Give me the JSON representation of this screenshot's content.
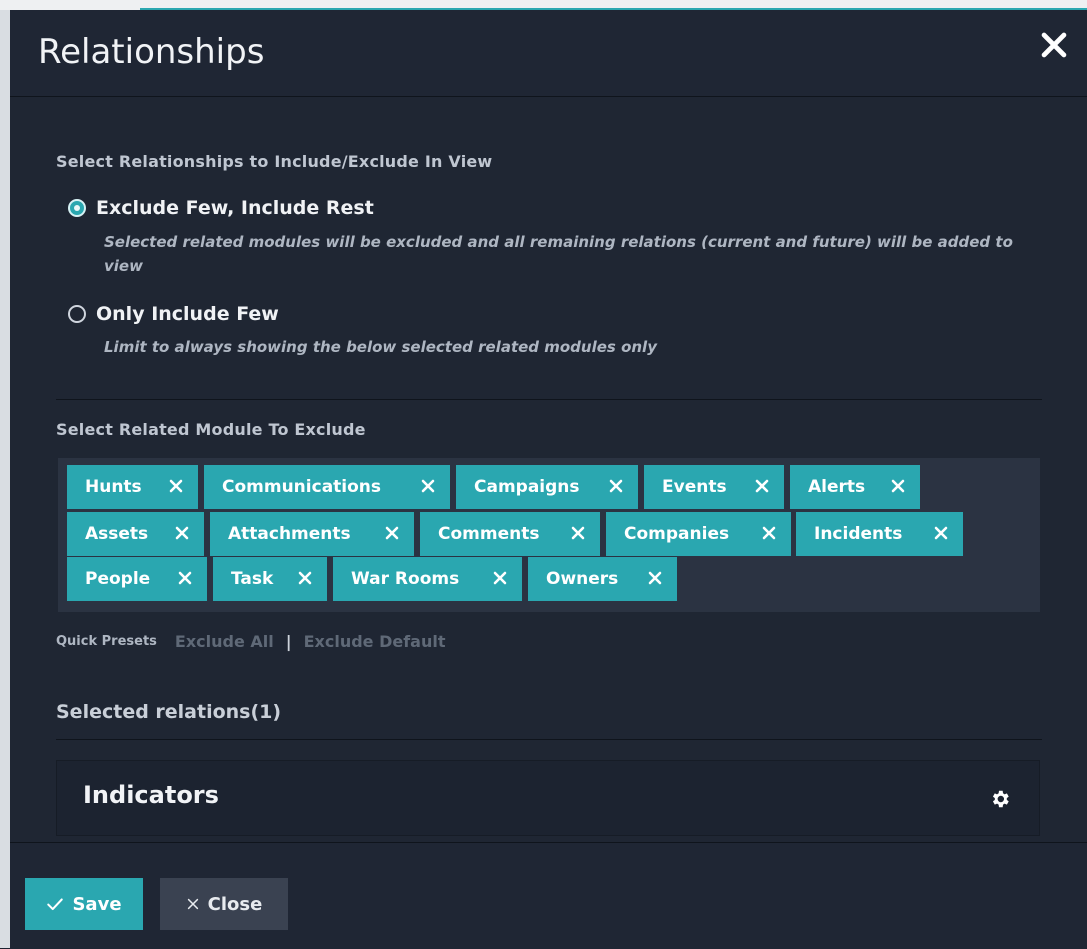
{
  "dialog": {
    "title": "Relationships"
  },
  "include_mode": {
    "heading": "Select Relationships to Include/Exclude In View",
    "options": [
      {
        "label": "Exclude Few, Include Rest",
        "help": "Selected related modules will be excluded and all remaining relations (current and future) will be added to view",
        "checked": true
      },
      {
        "label": "Only Include Few",
        "help": "Limit to always showing the below selected related modules only",
        "checked": false
      }
    ]
  },
  "exclude_modules": {
    "heading": "Select Related Module To Exclude",
    "tags": [
      "Hunts",
      "Communications",
      "Campaigns",
      "Events",
      "Alerts",
      "Assets",
      "Attachments",
      "Comments",
      "Companies",
      "Incidents",
      "People",
      "Task",
      "War Rooms",
      "Owners"
    ]
  },
  "presets": {
    "label": "Quick Presets",
    "exclude_all": "Exclude All",
    "separator": "|",
    "exclude_default": "Exclude Default"
  },
  "selected": {
    "heading": "Selected relations(1)",
    "items": [
      "Indicators"
    ]
  },
  "footer": {
    "save_label": "Save",
    "close_label": "Close"
  },
  "colors": {
    "accent": "#2aa7b0",
    "background": "#1f2633",
    "tag_box": "#2b3342"
  }
}
